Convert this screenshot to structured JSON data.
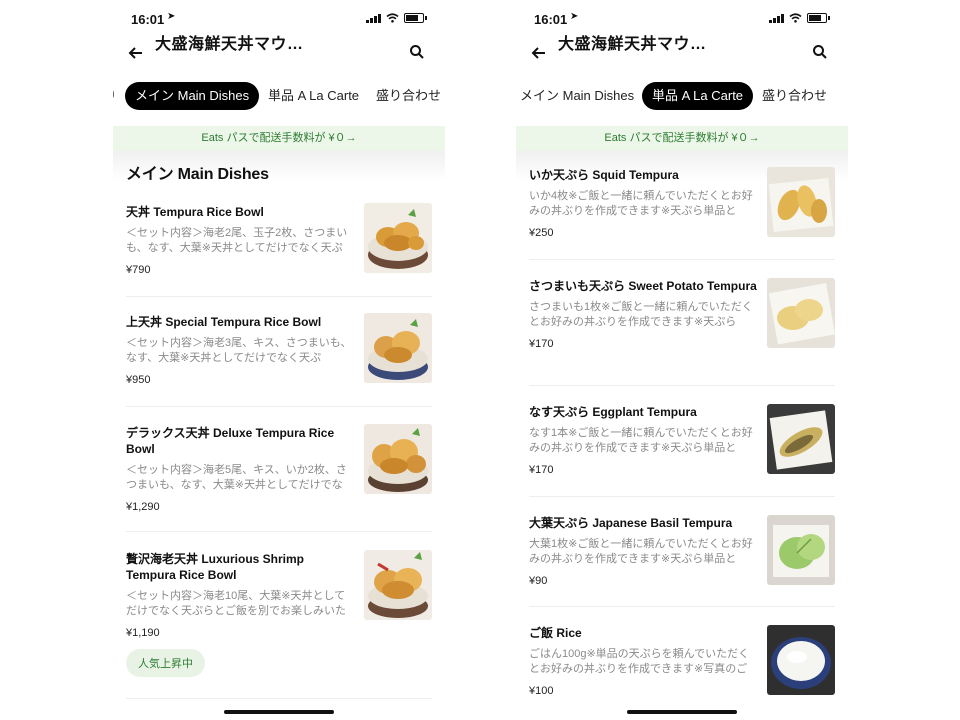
{
  "status": {
    "time": "16:01"
  },
  "store_title": "大盛海鮮天丼マウ…",
  "banner": "Eats パスで配送手数料が ¥０→",
  "left_screen": {
    "tabs": [
      "メイン Main Dishes",
      "単品 A La Carte",
      "盛り合わせ"
    ],
    "active_tab": "メイン Main Dishes",
    "section_title": "メイン Main Dishes",
    "items": [
      {
        "name": "天丼 Tempura Rice Bowl",
        "desc": "＜セット内容＞海老2尾、玉子2枚、さつまいも、なす、大葉※天丼としてだけでなく天ぷ",
        "price": "¥790"
      },
      {
        "name": "上天丼 Special Tempura Rice Bowl",
        "desc": "＜セット内容＞海老3尾、キス、さつまいも、なす、大葉※天丼としてだけでなく天ぷ",
        "price": "¥950"
      },
      {
        "name": "デラックス天丼 Deluxe Tempura Rice Bowl",
        "desc": "＜セット内容＞海老5尾、キス、いか2枚、さつまいも、なす、大葉※天丼としてだけでな",
        "price": "¥1,290"
      },
      {
        "name": "贅沢海老天丼 Luxurious Shrimp Tempura Rice Bowl",
        "desc": "＜セット内容＞海老10尾、大葉※天丼としてだけでなく天ぷらとご飯を別でお楽しみいた",
        "price": "¥1,190",
        "badge": "人気上昇中"
      }
    ]
  },
  "right_screen": {
    "tabs": [
      "メイン Main Dishes",
      "単品 A La Carte",
      "盛り合わせ"
    ],
    "active_tab": "単品 A La Carte",
    "items": [
      {
        "name": "いか天ぷら Squid Tempura",
        "desc": "いか4枚※ご飯と一緒に頼んでいただくとお好みの丼ぶりを作成できます※天ぷら単品と",
        "price": "¥250"
      },
      {
        "name": "さつまいも天ぷら Sweet Potato Tempura",
        "desc": "さつまいも1枚※ご飯と一緒に頼んでいただくとお好みの丼ぶりを作成できます※天ぷら",
        "price": "¥170"
      },
      {
        "name": "なす天ぷら Eggplant Tempura",
        "desc": "なす1本※ご飯と一緒に頼んでいただくとお好みの丼ぶりを作成できます※天ぷら単品と",
        "price": "¥170"
      },
      {
        "name": "大葉天ぷら Japanese Basil Tempura",
        "desc": "大葉1枚※ご飯と一緒に頼んでいただくとお好みの丼ぶりを作成できます※天ぷら単品と",
        "price": "¥90"
      },
      {
        "name": "ご飯 Rice",
        "desc": "ごはん100g※単品の天ぷらを頼んでいただくとお好みの丼ぶりを作成できます※写真のご",
        "price": "¥100"
      }
    ]
  },
  "icons": {
    "back": "arrow-left-icon",
    "search": "search-icon",
    "location": "location-arrow-icon",
    "signal": "cellular-signal-icon",
    "wifi": "wifi-icon",
    "battery": "battery-icon"
  },
  "colors": {
    "banner_bg": "#ecf6e9",
    "banner_text": "#2e7d32",
    "active_tab_bg": "#000000",
    "badge_bg": "#e8f3e6"
  }
}
